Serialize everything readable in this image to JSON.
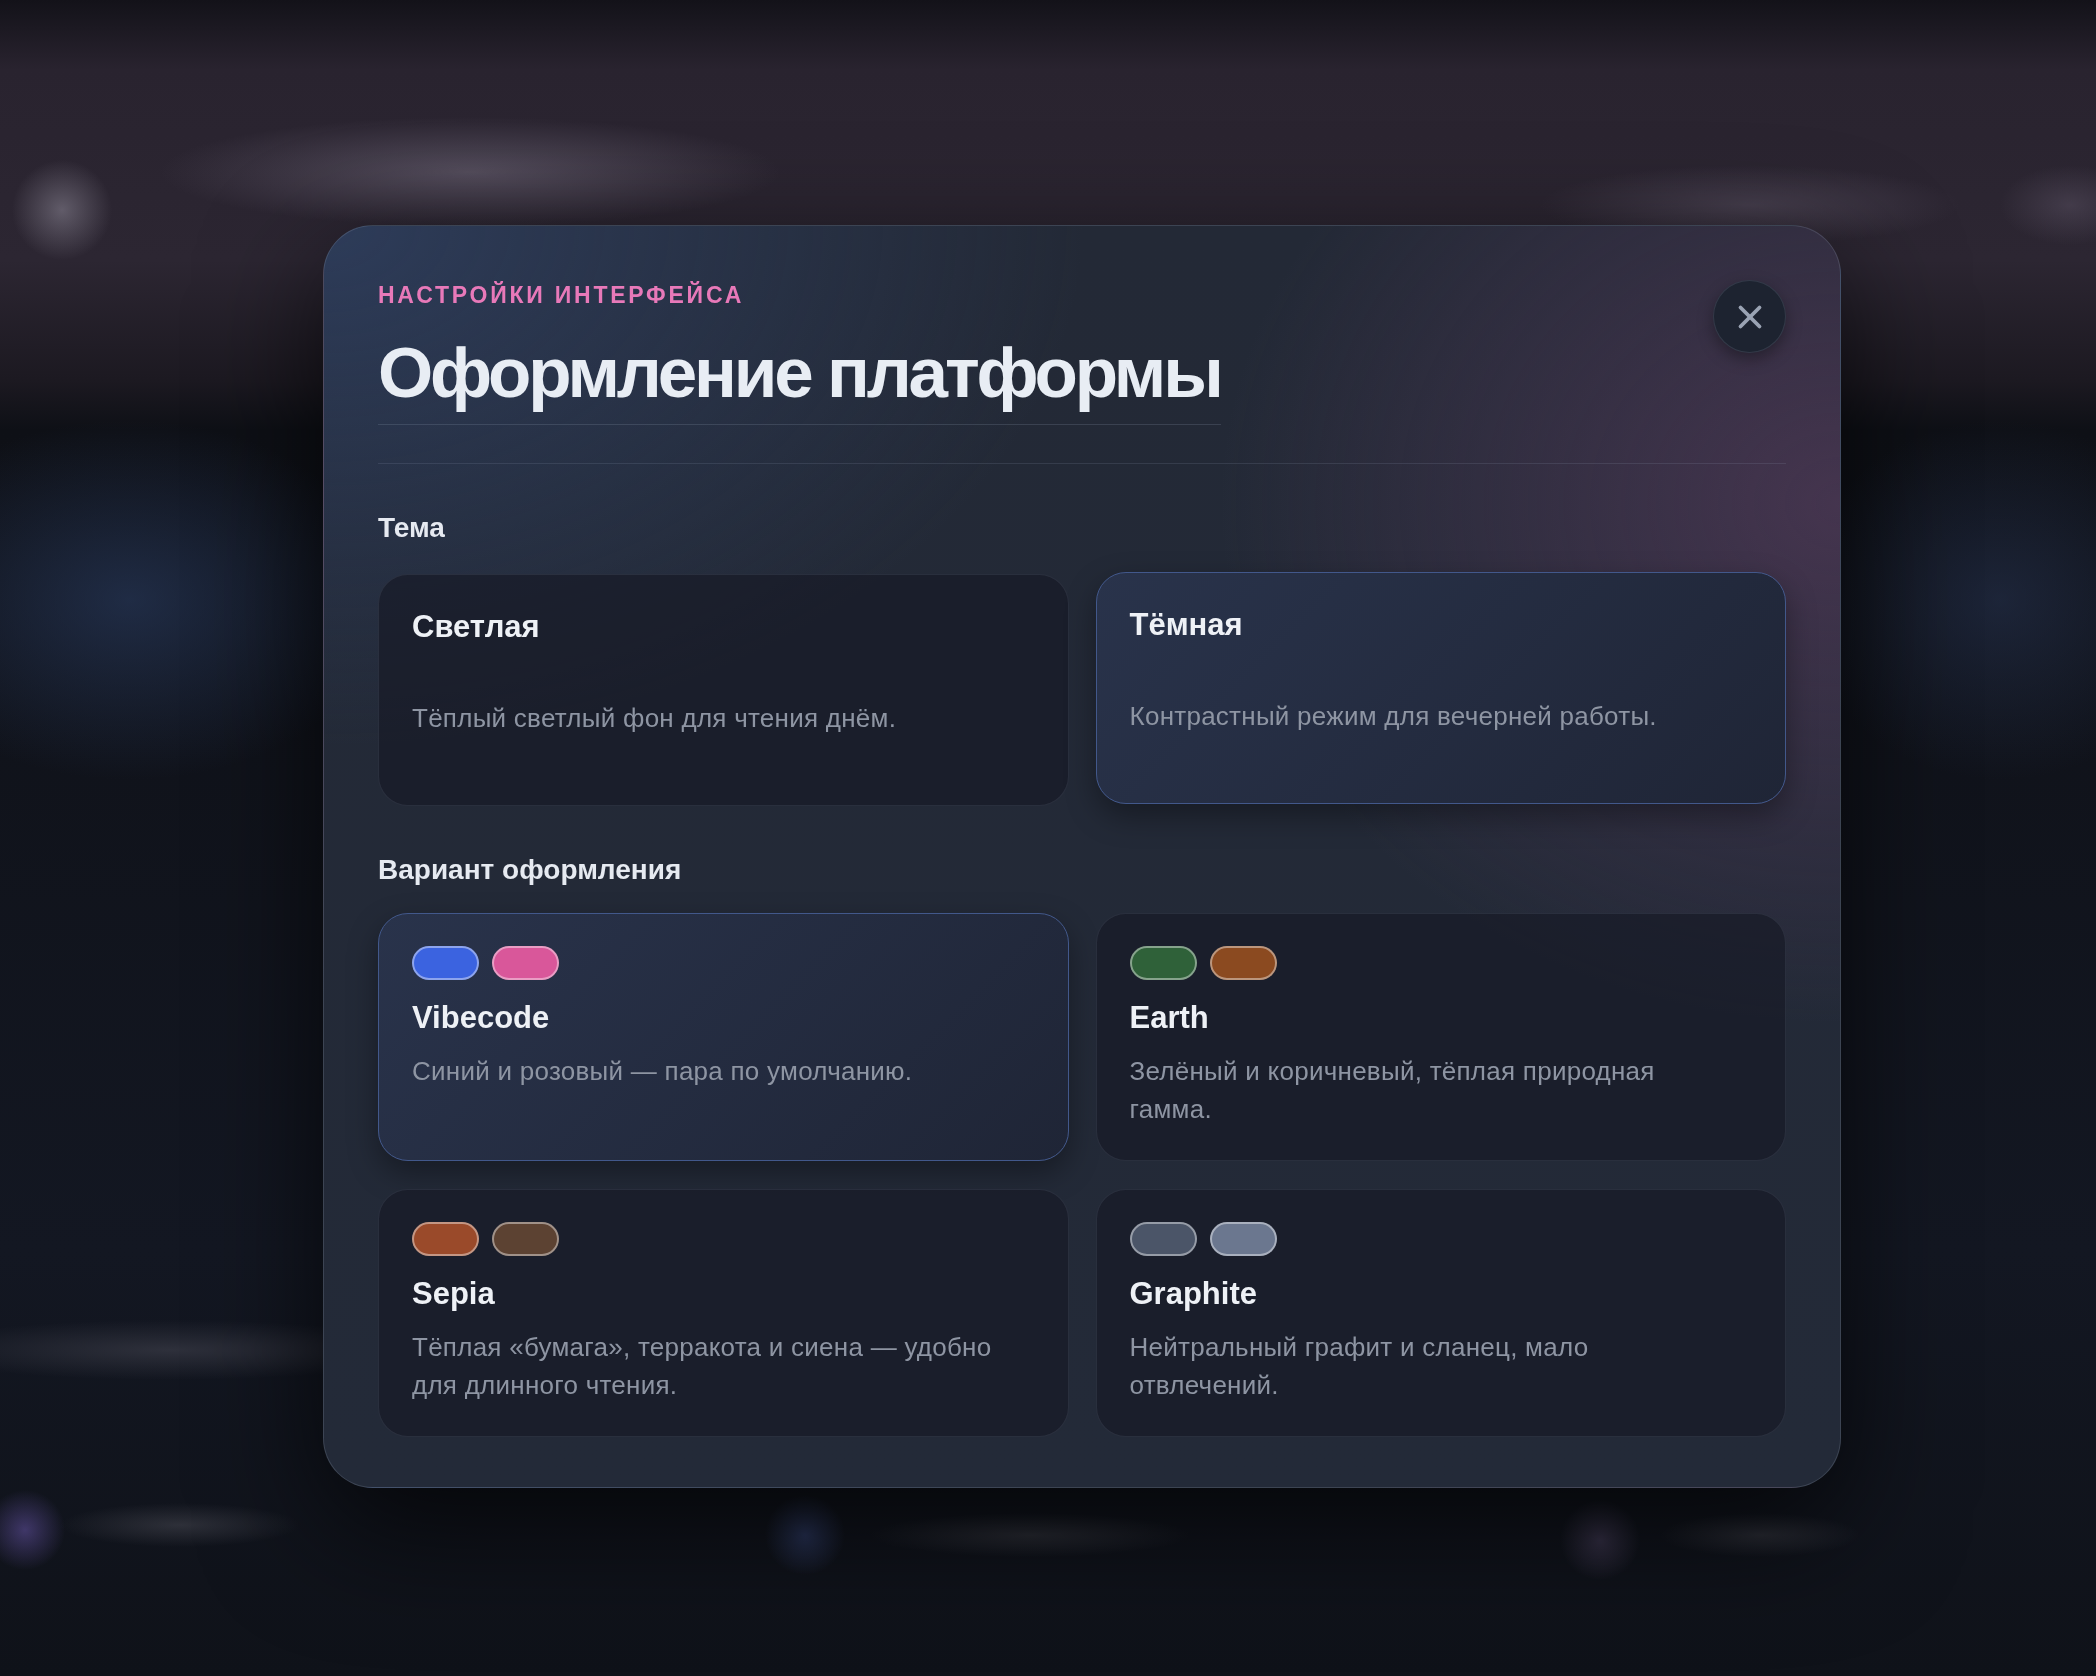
{
  "dialog": {
    "eyebrow": "НАСТРОЙКИ ИНТЕРФЕЙСА",
    "title": "Оформление платформы"
  },
  "theme": {
    "label": "Тема",
    "options": [
      {
        "name": "Светлая",
        "description": "Тёплый светлый фон для чтения днём.",
        "selected": false
      },
      {
        "name": "Тёмная",
        "description": "Контрастный режим для вечерней работы.",
        "selected": true
      }
    ]
  },
  "variant": {
    "label": "Вариант оформления",
    "options": [
      {
        "name": "Vibecode",
        "description": "Синий и розовый — пара по умолчанию.",
        "selected": true,
        "swatches": [
          {
            "color": "#3b63e0"
          },
          {
            "color": "#d9579a"
          }
        ]
      },
      {
        "name": "Earth",
        "description": "Зелёный и коричневый, тёплая природная\nгамма.",
        "selected": false,
        "swatches": [
          {
            "color": "#2f6139"
          },
          {
            "color": "#8b4a20"
          }
        ]
      },
      {
        "name": "Sepia",
        "description": "Тёплая «бумага», терракота и сиена — удобно\nдля длинного чтения.",
        "selected": false,
        "swatches": [
          {
            "color": "#9a4a2a"
          },
          {
            "color": "#5c4232"
          }
        ]
      },
      {
        "name": "Graphite",
        "description": "Нейтральный графит и сланец, мало\nотвлечений.",
        "selected": false,
        "swatches": [
          {
            "color": "#4b5568"
          },
          {
            "color": "#6b778f"
          }
        ]
      }
    ]
  }
}
